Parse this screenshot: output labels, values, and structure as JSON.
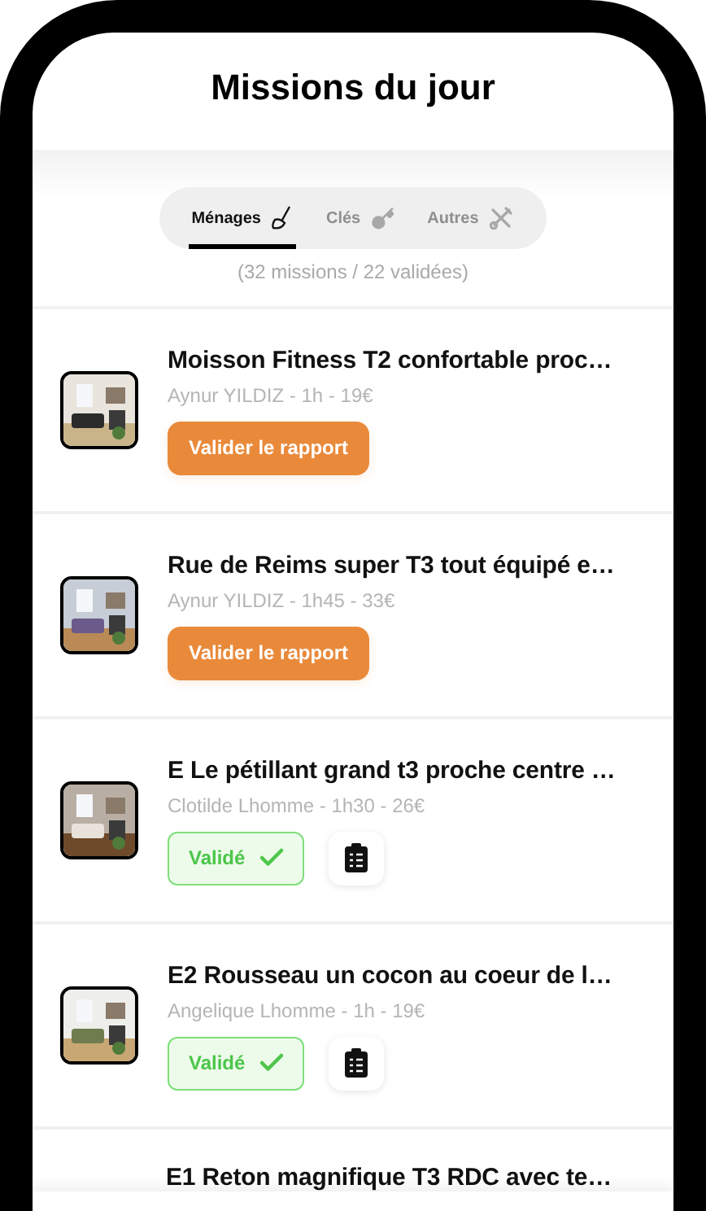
{
  "header": {
    "title": "Missions du jour"
  },
  "tabs": [
    {
      "label": "Ménages",
      "kind": "broom",
      "selected": true
    },
    {
      "label": "Clés",
      "kind": "key",
      "selected": false
    },
    {
      "label": "Autres",
      "kind": "tools",
      "selected": false
    }
  ],
  "summary": "(32 missions / 22 validées)",
  "missions": [
    {
      "title": "Moisson Fitness T2 confortable proc…",
      "subtitle": "Aynur YILDIZ - 1h - 19€",
      "kind": "pending",
      "action": "Valider le rapport"
    },
    {
      "title": "Rue de Reims super T3 tout équipé e…",
      "subtitle": "Aynur YILDIZ - 1h45 - 33€",
      "kind": "pending",
      "action": "Valider le rapport"
    },
    {
      "title": "E Le pétillant grand t3 proche centre …",
      "subtitle": "Clotilde Lhomme - 1h30 - 26€",
      "kind": "validated",
      "action": "Validé"
    },
    {
      "title": "E2 Rousseau un cocon au coeur de l…",
      "subtitle": "Angelique Lhomme - 1h - 19€",
      "kind": "validated",
      "action": "Validé"
    },
    {
      "title": "E1 Reton magnifique T3 RDC avec te…",
      "kind": "partial"
    }
  ]
}
